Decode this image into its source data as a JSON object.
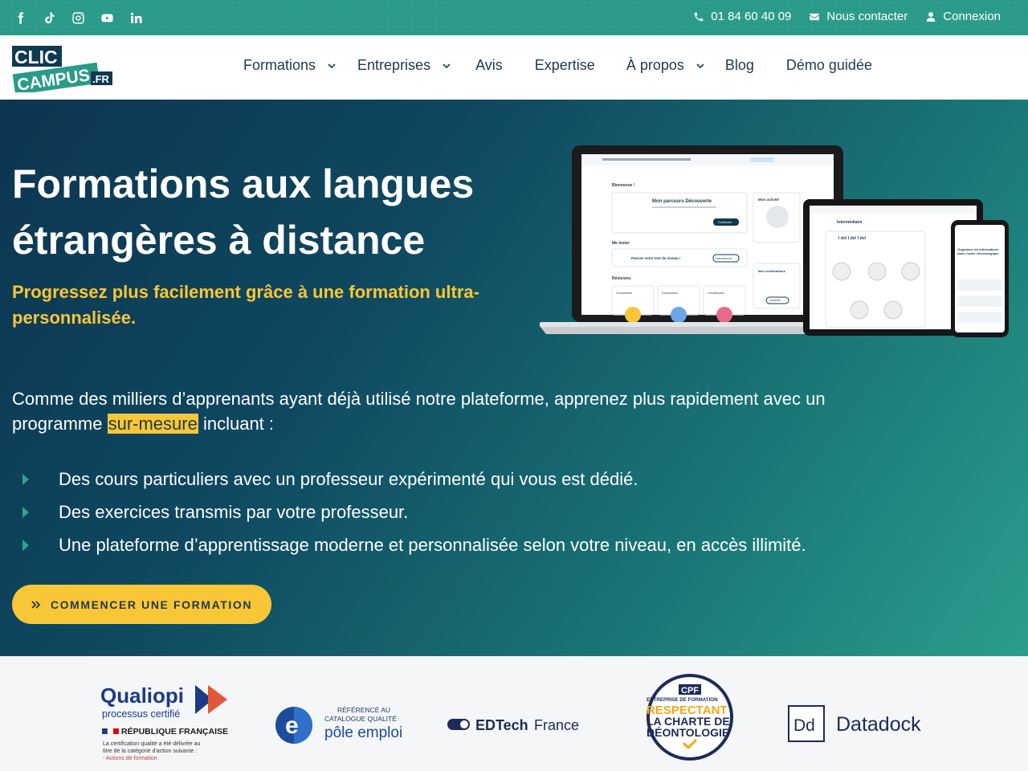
{
  "topbar": {
    "social": [
      "facebook-icon",
      "tiktok-icon",
      "instagram-icon",
      "youtube-icon",
      "linkedin-icon"
    ],
    "phone": "01 84 60 40 09",
    "contact": "Nous contacter",
    "login": "Connexion"
  },
  "logo": {
    "line1": "CLIC",
    "line2": "CAMPUS",
    "tld": ".FR"
  },
  "nav": {
    "items": [
      {
        "label": "Formations",
        "dropdown": true
      },
      {
        "label": "Entreprises",
        "dropdown": true
      },
      {
        "label": "Avis",
        "dropdown": false
      },
      {
        "label": "Expertise",
        "dropdown": false
      },
      {
        "label": "À propos",
        "dropdown": true
      },
      {
        "label": "Blog",
        "dropdown": false
      },
      {
        "label": "Démo guidée",
        "dropdown": false
      }
    ]
  },
  "hero": {
    "title": "Formations aux langues étrangères à distance",
    "subtitle": "Progressez plus facilement grâce à une formation ultra-personnalisée.",
    "para_before": "Comme des milliers d’apprenants ayant déjà utilisé notre plateforme, apprenez plus rapidement avec un programme ",
    "para_highlight": "sur-mesure",
    "para_after": " incluant :",
    "bullets": [
      "Des cours particuliers avec un professeur expérimenté qui vous est dédié.",
      "Des exercices transmis par votre professeur.",
      "Une plateforme d’apprentissage moderne et personnalisée selon votre niveau, en accès illimité."
    ],
    "cta": "COMMENCER UNE FORMATION"
  },
  "mockup": {
    "laptop_welcome": "Bienvenue !",
    "laptop_course": "Mon parcours Découverte",
    "laptop_course_btn": "Continuer",
    "laptop_activity": "Mon activité",
    "laptop_test": "Me tester",
    "laptop_test_line": "Passez votre test de niveau !",
    "laptop_test_btn": "Commencer",
    "laptop_reviews": "Révisions",
    "laptop_cards": [
      "Grammaire",
      "Expression",
      "Vocabulaire"
    ],
    "laptop_certs": "Mes certifications",
    "laptop_certs_btn": "Accéder",
    "tablet_title": "Intermédiaire",
    "tablet_sub": "I do! I do! I do!",
    "phone_title": "Organisez les informations dans l'ordre chronologique"
  },
  "badges": {
    "qualiopi_title": "Qualiopi",
    "qualiopi_sub": "processus certifié",
    "rf": "RÉPUBLIQUE FRANÇAISE",
    "qualiopi_note1": "La certification qualité a été délivrée au",
    "qualiopi_note2": "titre de la catégorie d'action suivante :",
    "qualiopi_note3": "- Actions de formation",
    "pe_ref1": "RÉFÉRENCÉ AU",
    "pe_ref2": "CATALOGUE QUALITÉ",
    "pe_name": "pôle emploi",
    "edtech_bold": "EDTech",
    "edtech_light": "France",
    "cpf_tag": "CPF",
    "cpf_l1": "ENTREPRISE DE FORMATION",
    "cpf_l2": "RESPECTANT",
    "cpf_l3": "LA CHARTE DE",
    "cpf_l4": "DÉONTOLOGIE",
    "datadock_mark": "Dd",
    "datadock_name": "Datadock"
  },
  "colors": {
    "teal": "#2b9b89",
    "navy": "#0c3550",
    "yellow": "#f9c637",
    "text": "#1f3a4a"
  }
}
